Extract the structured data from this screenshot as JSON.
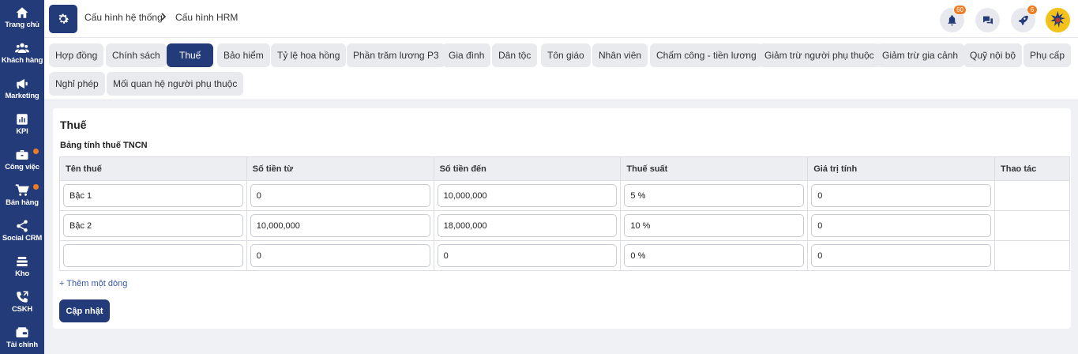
{
  "sidebar": {
    "items": [
      {
        "label": "Trang chủ",
        "icon": "home-icon"
      },
      {
        "label": "Khách hàng",
        "icon": "users-icon"
      },
      {
        "label": "Marketing",
        "icon": "megaphone-icon"
      },
      {
        "label": "KPI",
        "icon": "chart-icon"
      },
      {
        "label": "Công việc",
        "icon": "briefcase-icon",
        "dot": true
      },
      {
        "label": "Bán hàng",
        "icon": "cart-icon",
        "dot": true
      },
      {
        "label": "Social CRM",
        "icon": "share-icon"
      },
      {
        "label": "Kho",
        "icon": "warehouse-icon"
      },
      {
        "label": "CSKH",
        "icon": "phone-icon"
      },
      {
        "label": "Tài chính",
        "icon": "wallet-icon"
      }
    ]
  },
  "header": {
    "breadcrumb": [
      "Cấu hình hệ thống",
      "Cấu hình HRM"
    ],
    "notifications_count": "60",
    "rocket_count": "6"
  },
  "tabs": [
    "Hợp đồng",
    "Chính sách",
    "Thuế",
    "Bảo hiểm",
    "Tỷ lệ hoa hồng",
    "Phần trăm lương P3",
    "Gia đình",
    "Dân tộc",
    "Tôn giáo",
    "Nhân viên",
    "Chấm công - tiền lương",
    "Giảm trừ người phụ thuộc",
    "Giảm trừ gia cảnh",
    "Quỹ nội bộ",
    "Phụ cấp",
    "Nghỉ phép",
    "Mối quan hệ người phụ thuộc"
  ],
  "active_tab": "Thuế",
  "card": {
    "title": "Thuế",
    "subtitle": "Bảng tính thuế TNCN",
    "columns": [
      "Tên thuế",
      "Số tiền từ",
      "Số tiền đến",
      "Thuế suất",
      "Giá trị tính",
      "Thao tác"
    ],
    "rows": [
      [
        "Bậc 1",
        "0",
        "10,000,000",
        "5 %",
        "0"
      ],
      [
        "Bậc 2",
        "10,000,000",
        "18,000,000",
        "10 %",
        "0"
      ],
      [
        "",
        "0",
        "0",
        "0 %",
        "0"
      ]
    ],
    "add_row_label": "+ Thêm một dòng",
    "update_label": "Cập nhật"
  },
  "colors": {
    "primary": "#243b7a",
    "badge": "#f07b22",
    "background": "#f0f1f5"
  }
}
